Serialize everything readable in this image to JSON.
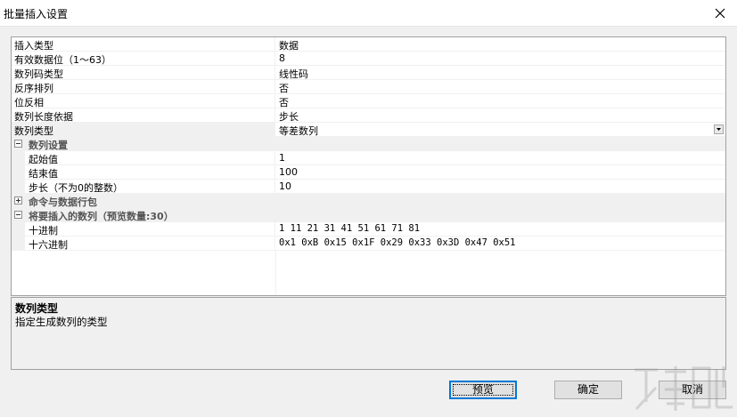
{
  "window": {
    "title": "批量插入设置"
  },
  "properties": [
    {
      "name": "插入类型",
      "value": "数据"
    },
    {
      "name": "有效数据位（1～63）",
      "value": "8"
    },
    {
      "name": "数列码类型",
      "value": "线性码"
    },
    {
      "name": "反序排列",
      "value": "否"
    },
    {
      "name": "位反相",
      "value": "否"
    },
    {
      "name": "数列长度依据",
      "value": "步长"
    },
    {
      "name": "数列类型",
      "value": "等差数列"
    }
  ],
  "sequence_settings": {
    "label": "数列设置",
    "rows": [
      {
        "name": "起始值",
        "value": "1"
      },
      {
        "name": "结束值",
        "value": "100"
      },
      {
        "name": "步长（不为0的整数）",
        "value": "10"
      }
    ]
  },
  "command_section": {
    "label": "命令与数据行包"
  },
  "preview_section": {
    "label": "将要插入的数列（预览数量:30）",
    "rows": [
      {
        "name": "十进制",
        "value": " 1 11 21 31 41 51 61 71 81"
      },
      {
        "name": "十六进制",
        "value": "0x1 0xB 0x15 0x1F 0x29 0x33 0x3D 0x47 0x51"
      }
    ]
  },
  "help": {
    "title": "数列类型",
    "description": "指定生成数列的类型"
  },
  "buttons": {
    "preview": "预览",
    "ok": "确定",
    "cancel": "取消"
  }
}
